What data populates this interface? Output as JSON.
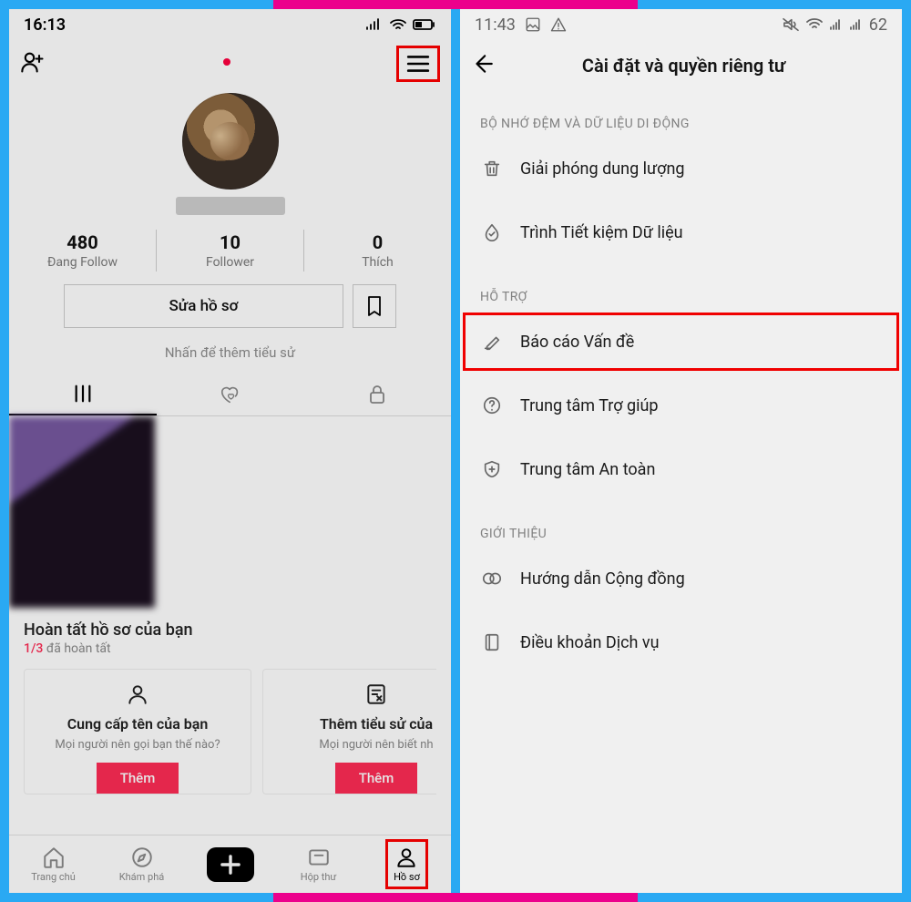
{
  "left": {
    "statusbar": {
      "time": "16:13"
    },
    "stats": {
      "following": {
        "value": "480",
        "label": "Đang Follow"
      },
      "followers": {
        "value": "10",
        "label": "Follower"
      },
      "likes": {
        "value": "0",
        "label": "Thích"
      }
    },
    "edit_profile": "Sửa hồ sơ",
    "add_bio": "Nhấn để thêm tiểu sử",
    "complete_profile": {
      "title": "Hoàn tất hồ sơ của bạn",
      "progress_done": "1/3",
      "progress_rest": " đã hoàn tất",
      "cards": [
        {
          "title": "Cung cấp tên của bạn",
          "desc": "Mọi người nên gọi bạn thế nào?",
          "btn": "Thêm"
        },
        {
          "title": "Thêm tiểu sử của",
          "desc": "Mọi người nên biết nh",
          "btn": "Thêm"
        }
      ]
    },
    "bottomnav": {
      "home": "Trang chủ",
      "discover": "Khám phá",
      "inbox": "Hộp thư",
      "profile": "Hồ sơ"
    }
  },
  "right": {
    "statusbar": {
      "time": "11:43",
      "battery": "62"
    },
    "header_title": "Cài đặt và quyền riêng tư",
    "sections": {
      "cache": {
        "label": "BỘ NHỚ ĐỆM VÀ DỮ LIỆU DI ĐỘNG",
        "free_space": "Giải phóng dung lượng",
        "data_saver": "Trình Tiết kiệm Dữ liệu"
      },
      "support": {
        "label": "HỖ TRỢ",
        "report": "Báo cáo Vấn đề",
        "help": "Trung tâm Trợ giúp",
        "safety": "Trung tâm An toàn"
      },
      "about": {
        "label": "GIỚI THIỆU",
        "guidelines": "Hướng dẫn Cộng đồng",
        "terms": "Điều khoản Dịch vụ"
      }
    }
  }
}
